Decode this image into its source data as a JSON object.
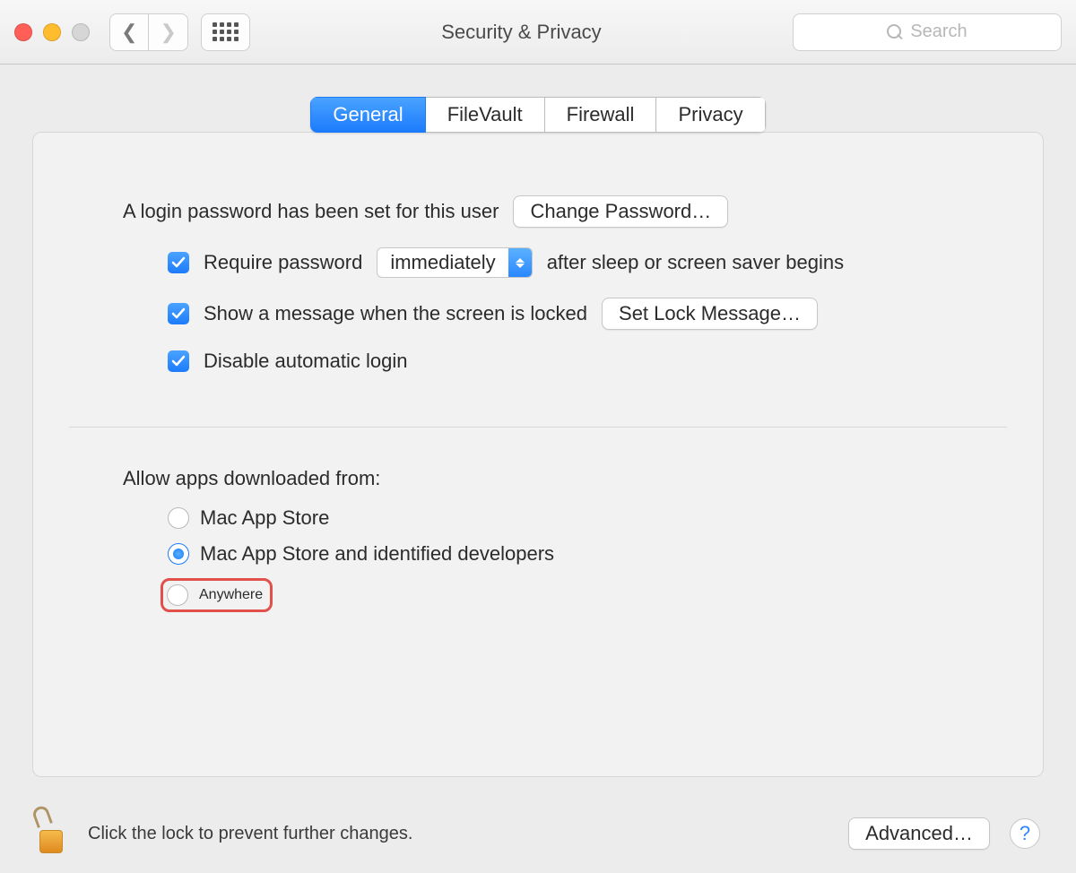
{
  "window": {
    "title": "Security & Privacy",
    "search_placeholder": "Search"
  },
  "tabs": {
    "general": "General",
    "filevault": "FileVault",
    "firewall": "Firewall",
    "privacy": "Privacy"
  },
  "general": {
    "login_password_text": "A login password has been set for this user",
    "change_password_btn": "Change Password…",
    "require_password_label": "Require password",
    "require_password_delay": "immediately",
    "require_password_suffix": "after sleep or screen saver begins",
    "show_message_label": "Show a message when the screen is locked",
    "set_lock_message_btn": "Set Lock Message…",
    "disable_auto_login_label": "Disable automatic login",
    "allow_apps_heading": "Allow apps downloaded from:",
    "radio_app_store": "Mac App Store",
    "radio_identified": "Mac App Store and identified developers",
    "radio_anywhere": "Anywhere"
  },
  "footer": {
    "lock_text": "Click the lock to prevent further changes.",
    "advanced_btn": "Advanced…",
    "help": "?"
  }
}
